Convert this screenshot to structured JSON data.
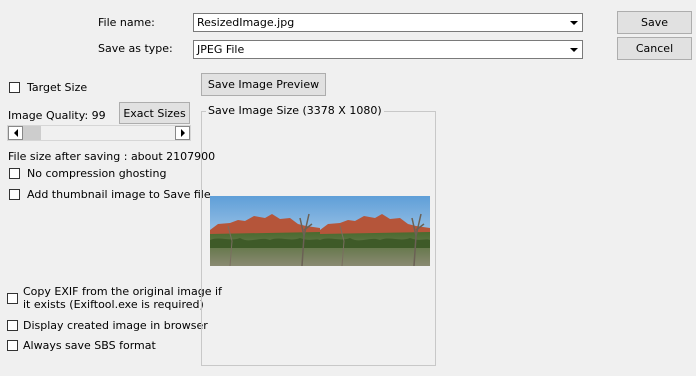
{
  "file_name": {
    "label": "File name:",
    "value": "ResizedImage.jpg"
  },
  "save_as_type": {
    "label": "Save as type:",
    "value": "JPEG File"
  },
  "buttons": {
    "save": "Save",
    "cancel": "Cancel",
    "save_image_preview": "Save Image Preview",
    "exact_sizes": "Exact Sizes"
  },
  "options": {
    "target_size": "Target Size",
    "image_quality_label": "Image Quality:",
    "image_quality_value": "99",
    "file_size": "File size after saving : about 2107900",
    "no_compression_ghosting": "No compression ghosting",
    "add_thumbnail": "Add thumbnail image to Save file",
    "copy_exif_line1": "Copy EXIF from the original image if",
    "copy_exif_line2": "it exists  (Exiftool.exe is required)",
    "display_in_browser": "Display created image in browser",
    "always_sbs": "Always save SBS format"
  },
  "preview": {
    "group_title": "Save Image Size (3378 X 1080)"
  },
  "colors": {
    "sky": "#6fa9de",
    "rock": "#b5553a",
    "foliage": "#4a6a2e"
  }
}
